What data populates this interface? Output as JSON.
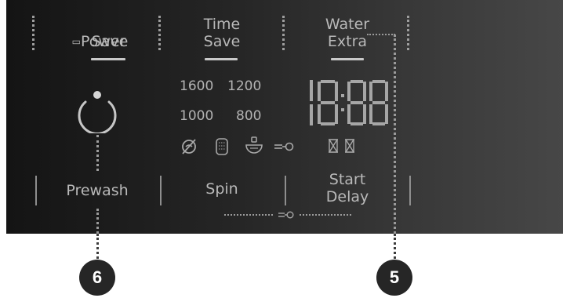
{
  "panel": {
    "power_save": {
      "symbol": "▭",
      "line1": "Power",
      "line2": "Save"
    },
    "time_save": {
      "line1": "Time",
      "line2": "Save"
    },
    "water_extra": {
      "line1": "Water",
      "line2": "Extra"
    },
    "prewash": {
      "label": "Prewash"
    },
    "spin": {
      "label": "Spin"
    },
    "start_delay": {
      "line1": "Start",
      "line2": "Delay"
    },
    "spin_speeds": [
      "1600",
      "1200",
      "1000",
      "800"
    ],
    "display": {
      "value": "18:88"
    },
    "icons": [
      "no-spin-icon",
      "drum-icon",
      "rinse-hold-icon",
      "child-lock-icon",
      "hourglass-icon",
      "hourglass-icon"
    ]
  },
  "callouts": {
    "prewash_marker": "6",
    "water_extra_marker": "5"
  }
}
